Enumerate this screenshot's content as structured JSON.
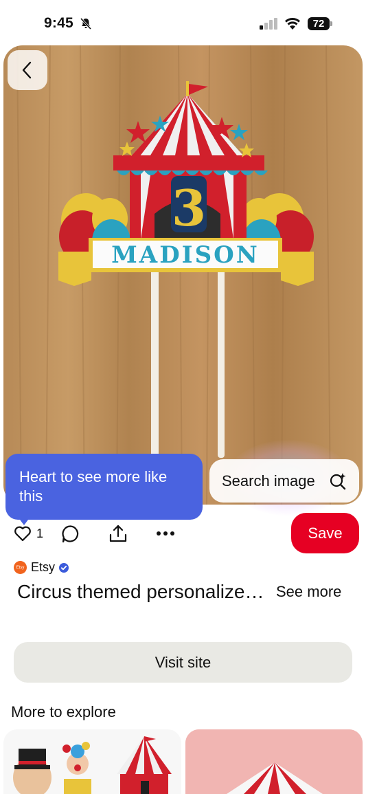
{
  "status_bar": {
    "time": "9:45",
    "battery": "72"
  },
  "pin": {
    "image_alt": "Circus themed cake topper with name and number"
  },
  "tooltip": {
    "text": "Heart to see more like this"
  },
  "search_image": {
    "label": "Search image"
  },
  "actions": {
    "like_count": "1",
    "save_label": "Save"
  },
  "source": {
    "name": "Etsy",
    "logo_text": "Etsy"
  },
  "title": {
    "text": "Circus themed personalized circus cake topper",
    "see_more": "See more"
  },
  "visit": {
    "label": "Visit site"
  },
  "explore": {
    "title": "More to explore"
  },
  "topper": {
    "number": "3",
    "name": "MADISON"
  },
  "colors": {
    "save_red": "#e60023",
    "tooltip_blue": "#4a63e0",
    "etsy_orange": "#f1641e",
    "verified_blue": "#3b5bdb"
  }
}
